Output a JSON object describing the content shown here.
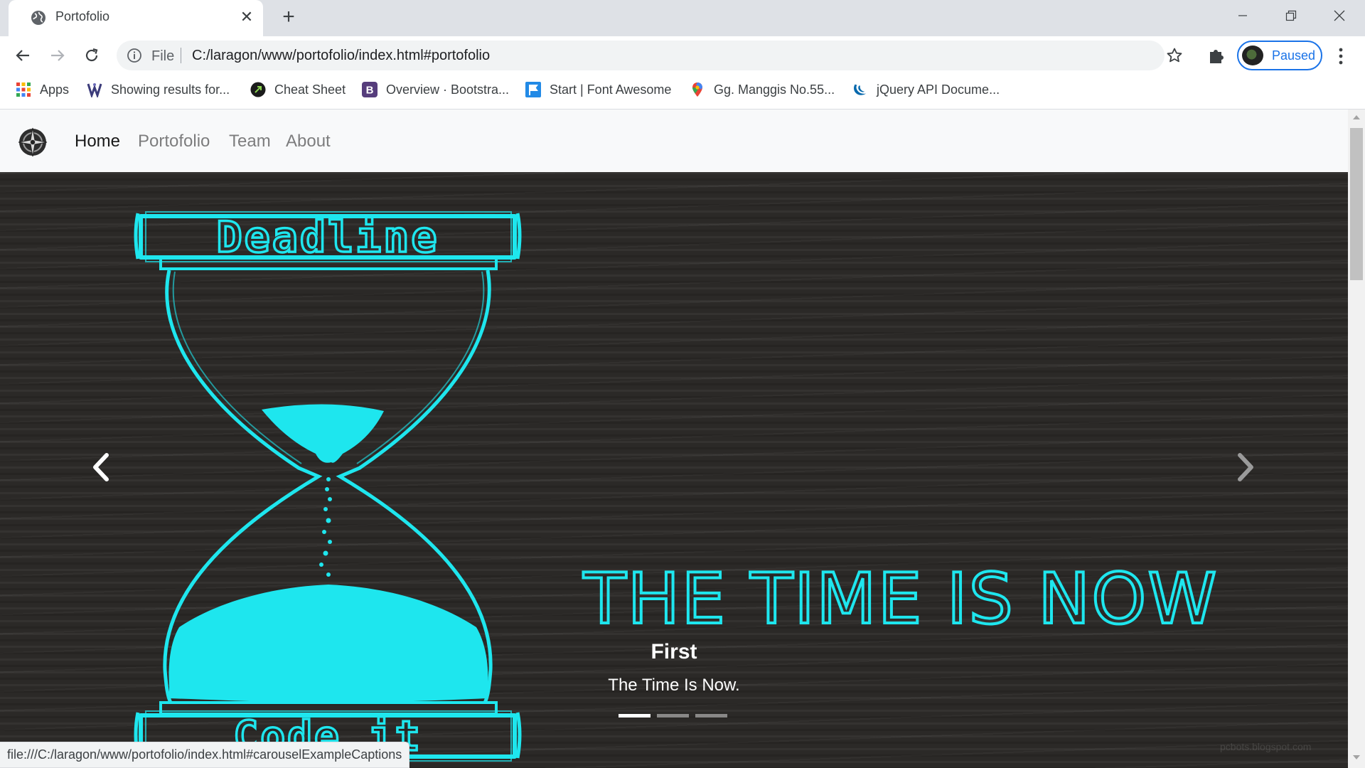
{
  "browser": {
    "tab": {
      "title": "Portofolio",
      "favicon": "globe-icon"
    },
    "omnibox": {
      "scheme": "File",
      "url": "C:/laragon/www/portofolio/index.html#portofolio"
    },
    "profile": {
      "label": "Paused"
    },
    "bookmarks": [
      {
        "label": "Apps",
        "icon": "apps-grid-icon"
      },
      {
        "label": "Showing results for...",
        "icon": "site-favicon-icon"
      },
      {
        "label": "Cheat Sheet",
        "icon": "cheat-sheet-favicon-icon"
      },
      {
        "label": "Overview · Bootstra...",
        "icon": "bootstrap-favicon-icon"
      },
      {
        "label": "Start | Font Awesome",
        "icon": "font-awesome-flag-icon"
      },
      {
        "label": "Gg. Manggis No.55...",
        "icon": "maps-pin-icon"
      },
      {
        "label": "jQuery API Docume...",
        "icon": "jquery-favicon-icon"
      }
    ],
    "status_url": "file:///C:/laragon/www/portofolio/index.html#carouselExampleCaptions"
  },
  "site": {
    "nav": [
      {
        "label": "Home",
        "active": true
      },
      {
        "label": "Portofolio",
        "active": false
      },
      {
        "label": "Team",
        "active": false
      },
      {
        "label": "About",
        "active": false
      }
    ],
    "carousel": {
      "slide_text": {
        "banner_top": "Deadline",
        "banner_bottom": "Code it",
        "headline": "THE TIME IS NOW"
      },
      "caption_title": "First",
      "caption_text": "The Time Is Now.",
      "indicators": 3,
      "active_index": 0,
      "watermark": "pcbots.blogspot.com",
      "art_color": "#1ee6ee"
    }
  }
}
